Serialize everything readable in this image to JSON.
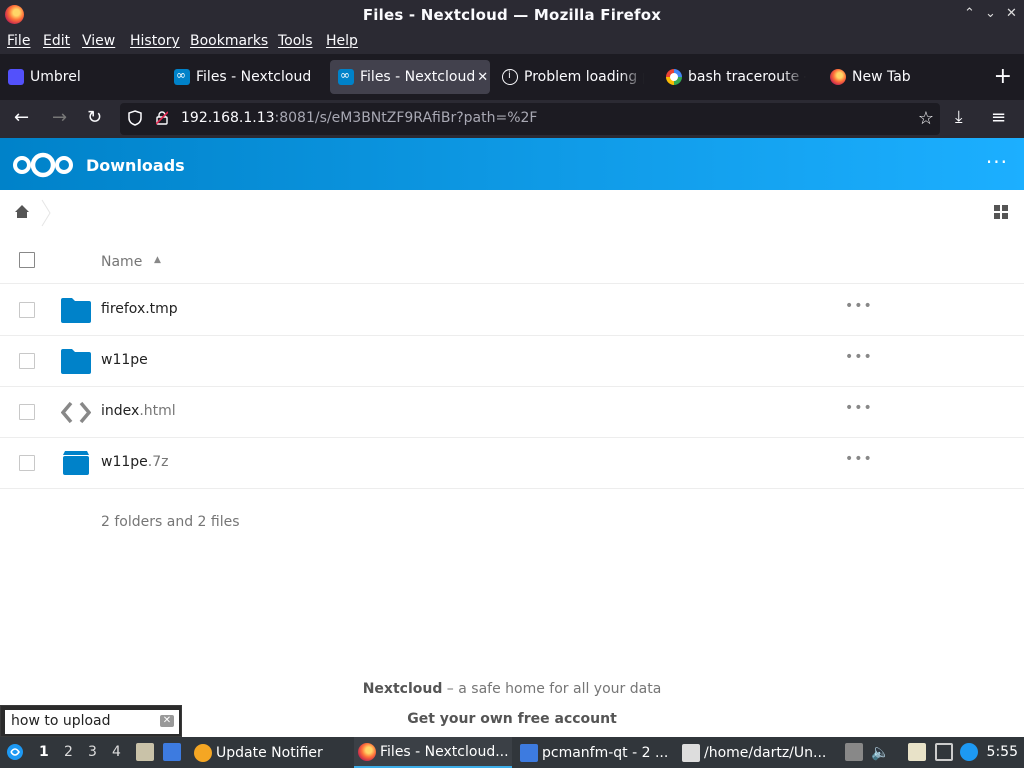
{
  "window": {
    "title": "Files - Nextcloud — Mozilla Firefox",
    "controls": [
      "minimize",
      "maximize",
      "close"
    ]
  },
  "menu": [
    "File",
    "Edit",
    "View",
    "History",
    "Bookmarks",
    "Tools",
    "Help"
  ],
  "tabs": [
    {
      "label": "Umbrel",
      "icon": "umbrel-icon"
    },
    {
      "label": "Files - Nextcloud",
      "icon": "nextcloud-icon"
    },
    {
      "label": "Files - Nextcloud",
      "icon": "nextcloud-icon",
      "active": true
    },
    {
      "label": "Problem loading p",
      "icon": "info-icon"
    },
    {
      "label": "bash traceroute -",
      "icon": "google-icon"
    },
    {
      "label": "New Tab",
      "icon": "firefox-icon"
    }
  ],
  "address": {
    "host": "192.168.1.13",
    "rest": ":8081/s/eM3BNtZF9RAfiBr?path=%2F"
  },
  "nextcloud": {
    "folder_title": "Downloads",
    "column_name": "Name",
    "files": [
      {
        "name": "firefox.tmp",
        "ext": "",
        "type": "folder"
      },
      {
        "name": "w11pe",
        "ext": "",
        "type": "folder"
      },
      {
        "name": "index",
        "ext": ".html",
        "type": "code"
      },
      {
        "name": "w11pe",
        "ext": ".7z",
        "type": "archive"
      }
    ],
    "summary": "2 folders and 2 files",
    "footer_brand": "Nextcloud",
    "footer_tagline": " – a safe home for all your data",
    "footer_cta": "Get your own free account"
  },
  "search_popup": {
    "value": "how to upload"
  },
  "taskbar": {
    "desktops": [
      "1",
      "2",
      "3",
      "4"
    ],
    "items": [
      {
        "label": "Update Notifier"
      },
      {
        "label": "Files - Nextcloud..."
      },
      {
        "label": "pcmanfm-qt - 2 ..."
      },
      {
        "label": "/home/dartz/Un..."
      }
    ],
    "clock": "5:55"
  },
  "colors": {
    "nextcloud_blue": "#0082c9",
    "firefox_dark": "#2b2a33",
    "taskbar": "#31363b"
  }
}
